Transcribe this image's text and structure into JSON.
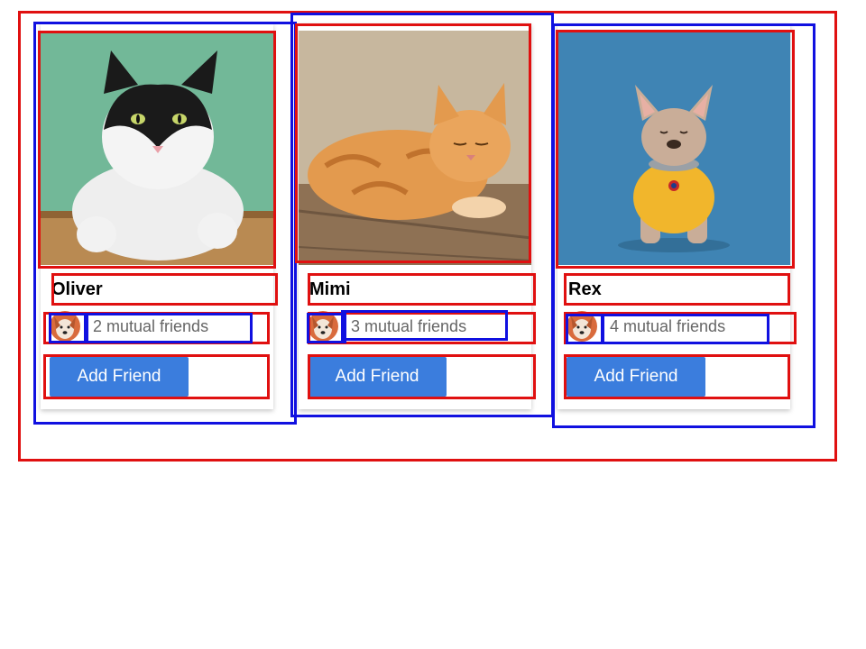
{
  "cards": [
    {
      "name": "Oliver",
      "mutual": "2 mutual friends",
      "button": "Add Friend",
      "photo": "black-white-cat",
      "bg": "#6fb894"
    },
    {
      "name": "Mimi",
      "mutual": "3 mutual friends",
      "button": "Add Friend",
      "photo": "orange-tabby-cat",
      "bg": "#b9a58a"
    },
    {
      "name": "Rex",
      "mutual": "4 mutual friends",
      "button": "Add Friend",
      "photo": "french-bulldog",
      "bg": "#3f84b4"
    }
  ],
  "colors": {
    "button": "#3b7ddd",
    "annotation_red": "#e01010",
    "annotation_blue": "#1010e0"
  }
}
